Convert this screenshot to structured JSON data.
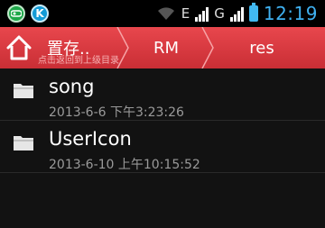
{
  "status_bar": {
    "clock": "12:19",
    "network_primary": "E",
    "network_secondary": "G",
    "sim2_label": "2",
    "battery_color": "#41b8f0",
    "clock_color": "#3fb0f0"
  },
  "breadcrumb": {
    "items": [
      {
        "label": "置存..",
        "sub": "点击返回到上级目录"
      },
      {
        "label": "RM"
      },
      {
        "label": "res"
      }
    ],
    "bar_color": "#d9393f"
  },
  "files": [
    {
      "name": "song",
      "modified": "2013-6-6 下午3:23:26"
    },
    {
      "name": "UserIcon",
      "modified": "2013-6-10 上午10:15:52"
    }
  ]
}
